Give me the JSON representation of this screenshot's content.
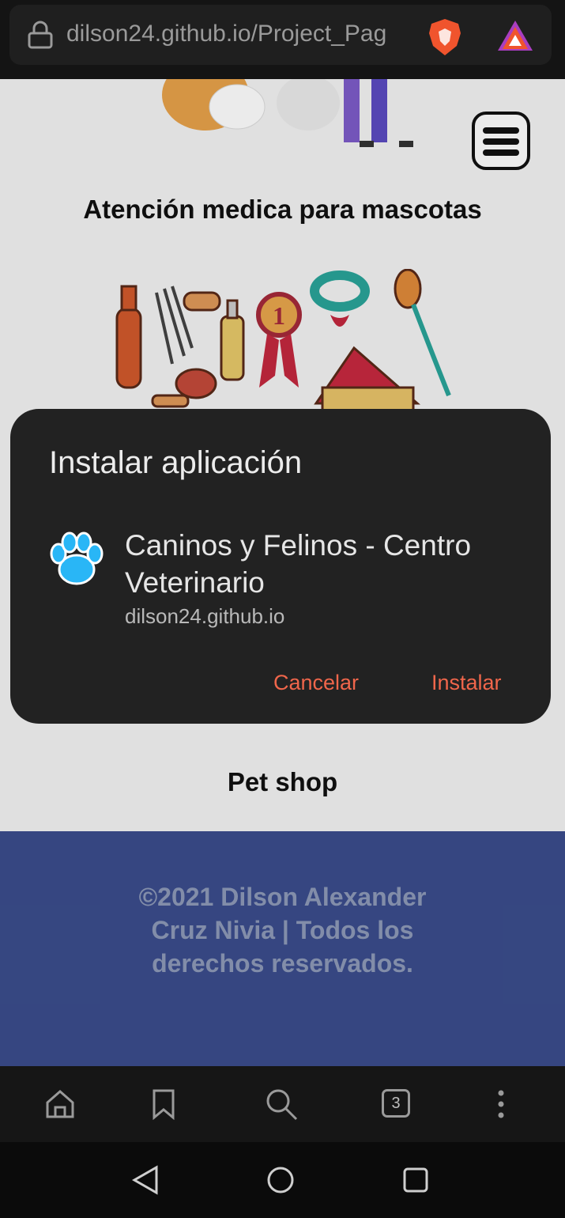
{
  "browser": {
    "url": "dilson24.github.io/Project_Pag",
    "lock_icon": "lock-icon",
    "brave_icon": "brave-shield-icon",
    "rewards_icon": "brave-rewards-triangle-icon"
  },
  "page": {
    "heading_medical": "Atención medica para mascotas",
    "heading_shop": "Pet shop",
    "menu_icon": "hamburger-menu-icon",
    "footer_text": "©2021 Dilson Alexander Cruz Nivia | Todos los derechos reservados."
  },
  "dialog": {
    "title": "Instalar aplicación",
    "app_name": "Caninos y Felinos - Centro Veterinario",
    "app_url": "dilson24.github.io",
    "app_icon": "paw-icon",
    "cancel_label": "Cancelar",
    "install_label": "Instalar"
  },
  "toolbar": {
    "home_icon": "home-icon",
    "bookmark_icon": "bookmark-icon",
    "search_icon": "search-icon",
    "tabs_count": "3",
    "menu_icon": "more-vertical-icon"
  },
  "system_nav": {
    "back_icon": "back-triangle-icon",
    "home_icon": "home-circle-icon",
    "recents_icon": "recents-square-icon"
  },
  "colors": {
    "accent": "#f0664b",
    "dialog_bg": "#222222",
    "footer_bg": "#3b4d8c",
    "paw": "#29b6f6"
  }
}
